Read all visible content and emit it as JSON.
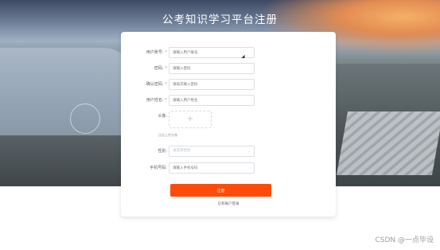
{
  "page": {
    "title": "公考知识学习平台注册"
  },
  "form": {
    "fields": [
      {
        "label": "用户账号:",
        "required": true,
        "placeholder": "请输入用户账号"
      },
      {
        "label": "密码:",
        "required": true,
        "placeholder": "请输入密码"
      },
      {
        "label": "确认密码:",
        "required": true,
        "placeholder": "请再次输入密码"
      },
      {
        "label": "用户姓名:",
        "required": true,
        "placeholder": "请输入用户姓名"
      },
      {
        "label": "头像:",
        "required": false,
        "placeholder": "+"
      },
      {
        "label": "性别:",
        "required": false,
        "placeholder": "请选择性别"
      },
      {
        "label": "手机号码:",
        "required": false,
        "placeholder": "请输入手机号码"
      }
    ],
    "upload_hint": "点击上传头像",
    "register_label": "注册",
    "login_link": "已有账户登录"
  },
  "watermark": "CSDN @一点毕设",
  "colors": {
    "accent": "#ff4b0a",
    "required": "#f56c6c"
  }
}
